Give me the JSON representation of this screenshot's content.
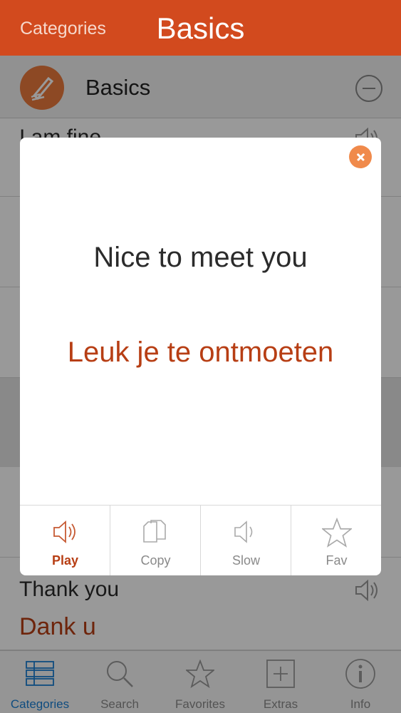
{
  "navbar": {
    "back_label": "Categories",
    "title": "Basics"
  },
  "category": {
    "title": "Basics",
    "icon": "pencil-icon"
  },
  "list": {
    "rows": [
      {
        "english": "I am fine",
        "dutch": ""
      },
      {
        "english": "Thank you",
        "dutch": "Dank u"
      }
    ]
  },
  "modal": {
    "english": "Nice to meet you",
    "dutch": "Leuk je te ontmoeten",
    "actions": [
      {
        "label": "Play",
        "icon": "speaker-icon",
        "active": true
      },
      {
        "label": "Copy",
        "icon": "copy-icon",
        "active": false
      },
      {
        "label": "Slow",
        "icon": "speaker-slow-icon",
        "active": false
      },
      {
        "label": "Fav",
        "icon": "star-icon",
        "active": false
      }
    ]
  },
  "tabbar": {
    "tabs": [
      {
        "label": "Categories",
        "icon": "list-icon",
        "active": true
      },
      {
        "label": "Search",
        "icon": "search-icon",
        "active": false
      },
      {
        "label": "Favorites",
        "icon": "star-icon",
        "active": false
      },
      {
        "label": "Extras",
        "icon": "plus-box-icon",
        "active": false
      },
      {
        "label": "Info",
        "icon": "info-icon",
        "active": false
      }
    ]
  },
  "colors": {
    "brand": "#d24a1e",
    "dutch_text": "#b73e14",
    "accent": "#f08a4b",
    "tab_active": "#1a7fd4"
  }
}
